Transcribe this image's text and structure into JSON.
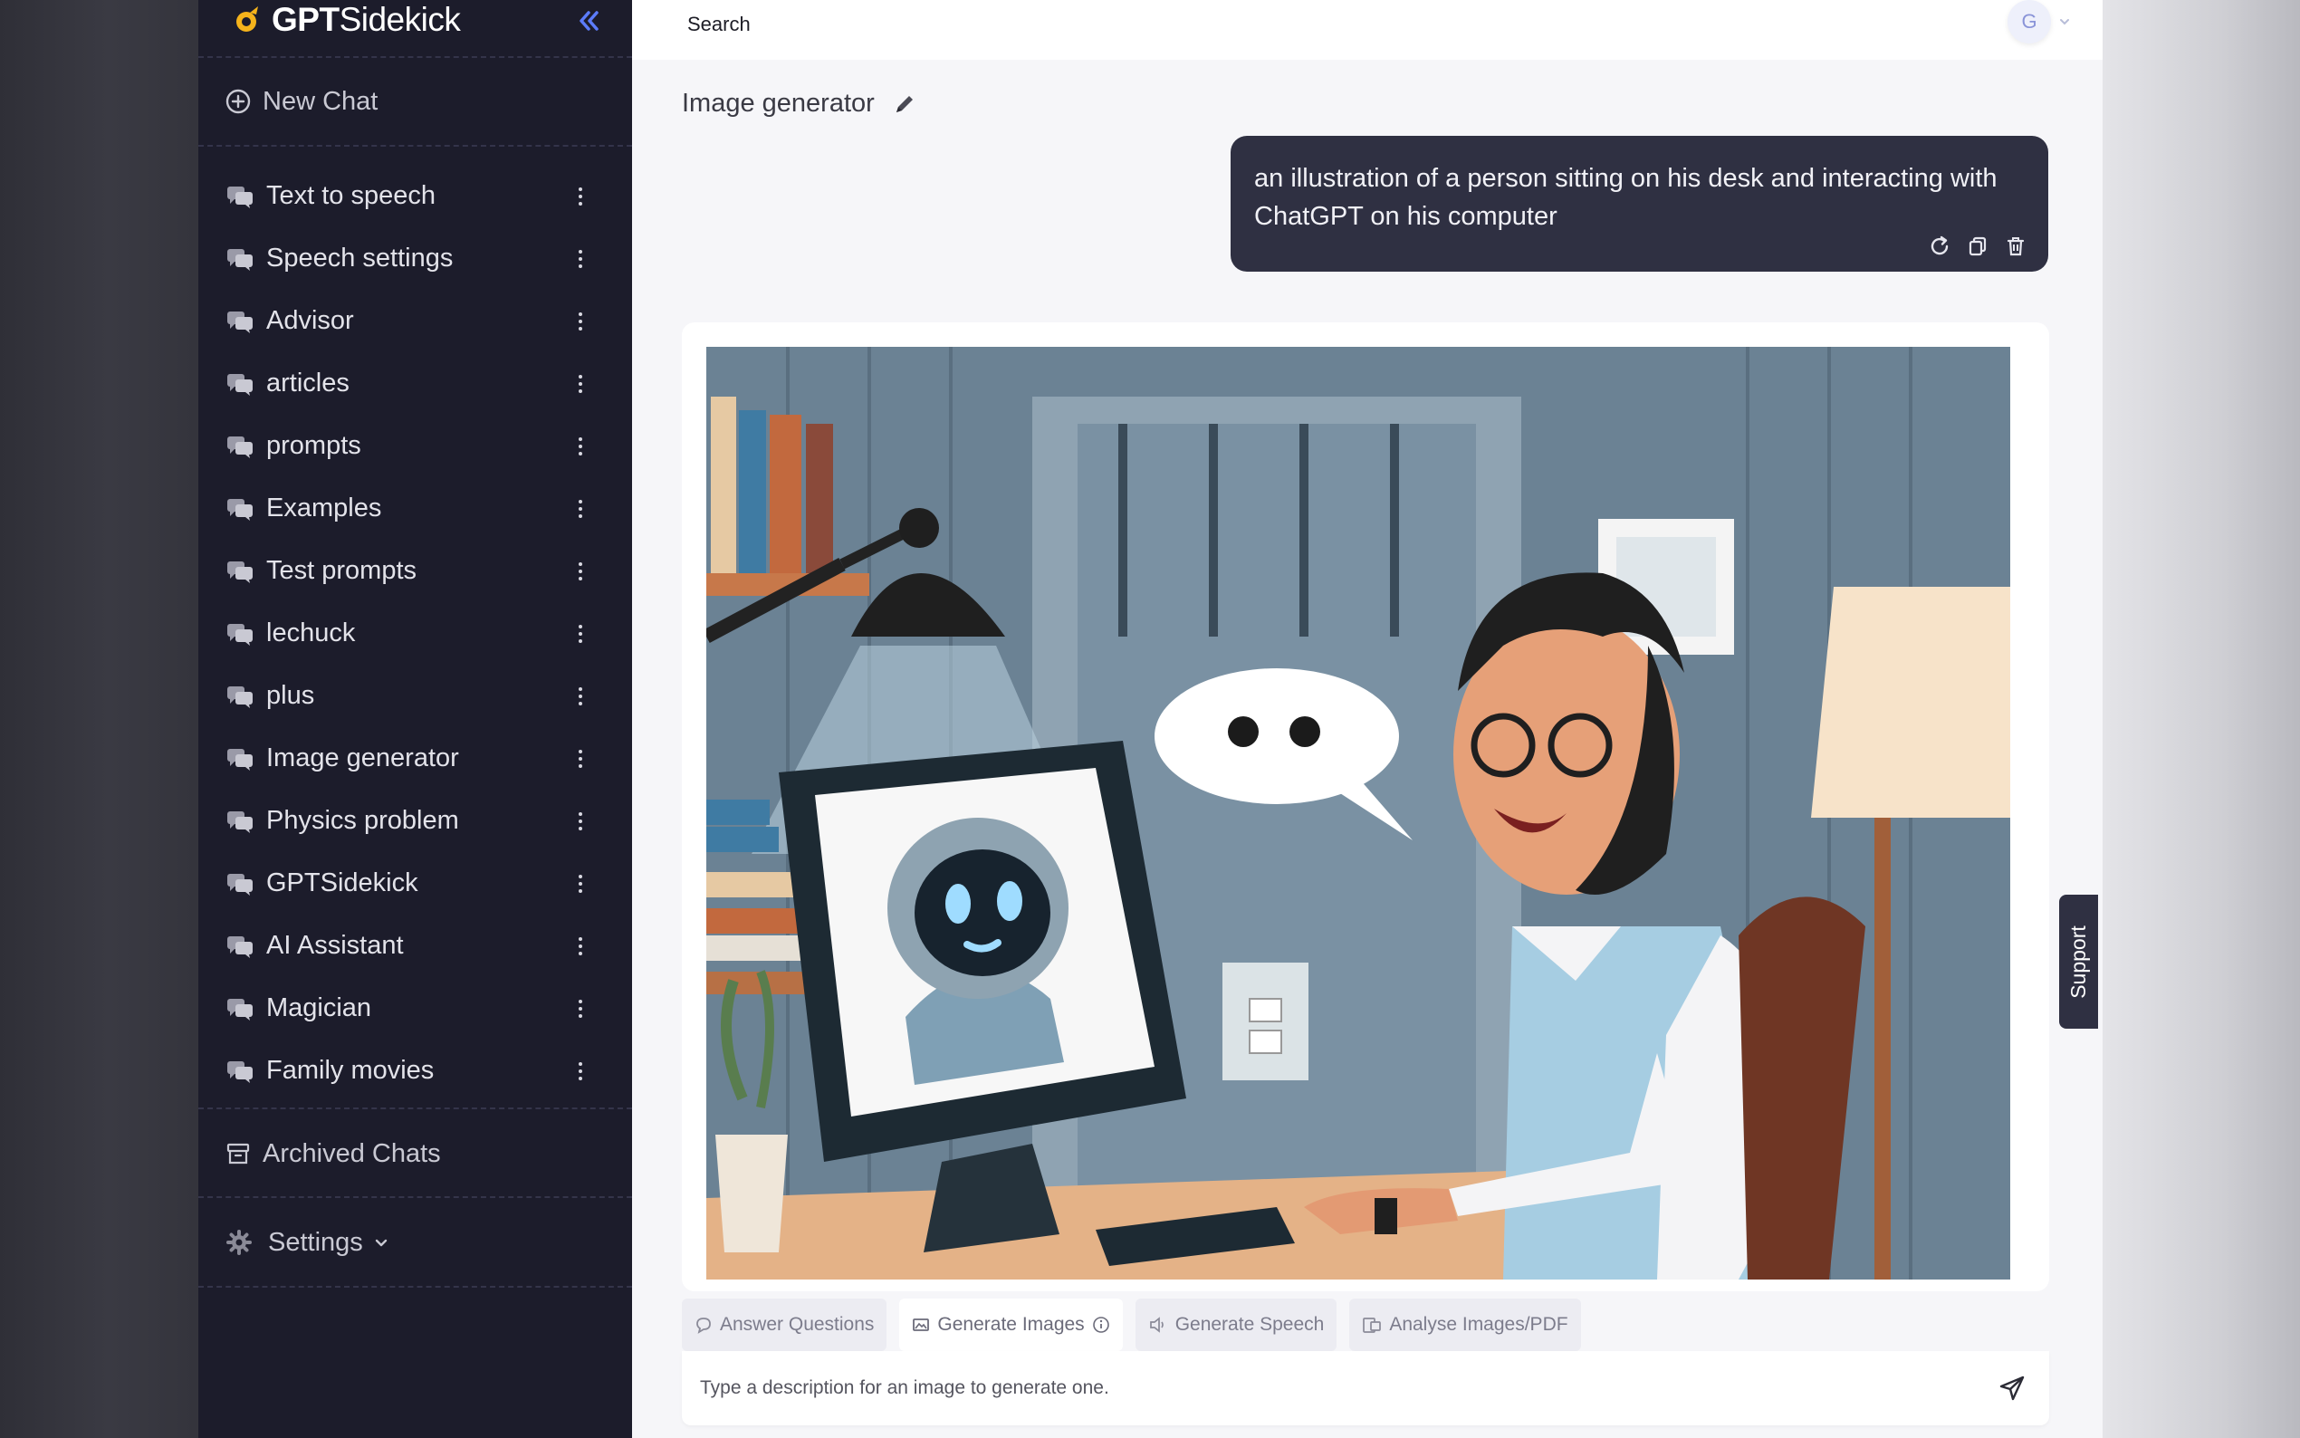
{
  "brand": {
    "name_bold": "GPT",
    "name_rest": "Sidekick"
  },
  "sidebar": {
    "new_chat": "New Chat",
    "chats": [
      {
        "label": "Text to speech"
      },
      {
        "label": "Speech settings"
      },
      {
        "label": "Advisor"
      },
      {
        "label": "articles"
      },
      {
        "label": "prompts"
      },
      {
        "label": "Examples"
      },
      {
        "label": "Test prompts"
      },
      {
        "label": "lechuck"
      },
      {
        "label": "plus"
      },
      {
        "label": "Image generator"
      },
      {
        "label": "Physics problem"
      },
      {
        "label": "GPTSidekick"
      },
      {
        "label": "AI Assistant"
      },
      {
        "label": "Magician"
      },
      {
        "label": "Family movies"
      }
    ],
    "archived": "Archived Chats",
    "settings": "Settings"
  },
  "topbar": {
    "search": "Search",
    "avatar_initial": "G"
  },
  "chat": {
    "title": "Image generator",
    "user_message": "an illustration of a person sitting on his desk and interacting with ChatGPT on his computer"
  },
  "modes": {
    "answer": "Answer Questions",
    "images": "Generate Images",
    "speech": "Generate Speech",
    "analyse": "Analyse Images/PDF"
  },
  "prompt": {
    "placeholder": "Type a description for an image to generate one."
  },
  "support": "Support",
  "colors": {
    "sidebar_bg": "#1c1c2b",
    "bubble_bg": "#2f3042",
    "accent": "#5c7cfa",
    "main_bg": "#f6f6f9"
  }
}
